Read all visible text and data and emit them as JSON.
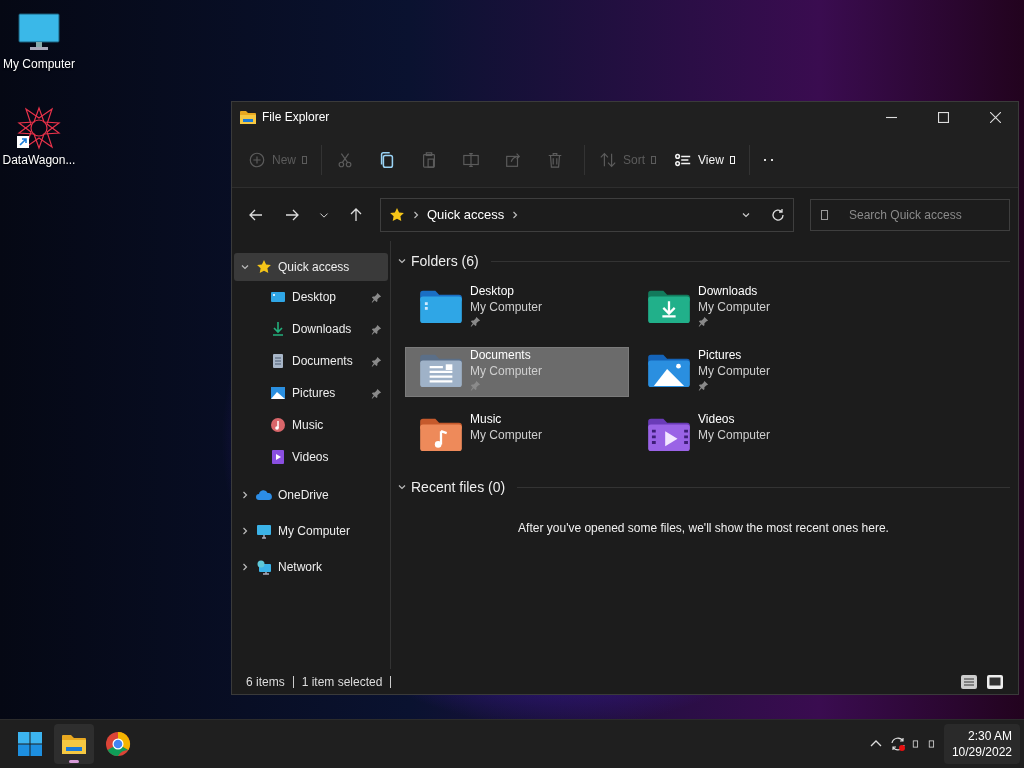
{
  "desktop_icons": [
    {
      "label": "My Computer",
      "kind": "monitor",
      "shortcut": false
    },
    {
      "label": "DataWagon...",
      "kind": "app",
      "shortcut": true
    }
  ],
  "window": {
    "title": "File Explorer"
  },
  "toolbar": [
    {
      "kind": "new",
      "label": "New",
      "disabled": true,
      "dropdown": true
    },
    {
      "kind": "cut",
      "disabled": true
    },
    {
      "kind": "copy",
      "disabled": false
    },
    {
      "kind": "paste",
      "disabled": true
    },
    {
      "kind": "rename",
      "disabled": true
    },
    {
      "kind": "share",
      "disabled": true
    },
    {
      "kind": "delete",
      "disabled": true
    },
    {
      "kind": "sort",
      "label": "Sort",
      "disabled": true,
      "dropdown": true
    },
    {
      "kind": "view",
      "label": "View",
      "disabled": false,
      "dropdown": true
    },
    {
      "kind": "more"
    }
  ],
  "address": {
    "breadcrumb": "Quick access"
  },
  "search": {
    "placeholder": "Search Quick access"
  },
  "nav": [
    {
      "label": "Quick access",
      "kind": "star",
      "expanded": true,
      "selected": true,
      "children": [
        {
          "label": "Desktop",
          "kind": "desktop",
          "pinned": true,
          "selected": false
        },
        {
          "label": "Downloads",
          "kind": "downloads",
          "pinned": true,
          "selected": false
        },
        {
          "label": "Documents",
          "kind": "documents",
          "pinned": true,
          "selected": false
        },
        {
          "label": "Pictures",
          "kind": "pictures",
          "pinned": true,
          "selected": false
        },
        {
          "label": "Music",
          "kind": "music",
          "pinned": false,
          "selected": false
        },
        {
          "label": "Videos",
          "kind": "videos",
          "pinned": false,
          "selected": false
        }
      ]
    },
    {
      "label": "OneDrive",
      "kind": "cloud",
      "expanded": false,
      "selected": false
    },
    {
      "label": "My Computer",
      "kind": "monitor",
      "expanded": false,
      "selected": false
    },
    {
      "label": "Network",
      "kind": "network",
      "expanded": false,
      "selected": false
    }
  ],
  "folders_section": {
    "title": "Folders (6)",
    "expanded": true,
    "folders": [
      {
        "name": "Desktop",
        "location": "My Computer",
        "kind": "desktop",
        "pinned": true,
        "selected": false
      },
      {
        "name": "Downloads",
        "location": "My Computer",
        "kind": "downloads",
        "pinned": true,
        "selected": false
      },
      {
        "name": "Documents",
        "location": "My Computer",
        "kind": "documents",
        "pinned": true,
        "selected": true
      },
      {
        "name": "Pictures",
        "location": "My Computer",
        "kind": "pictures",
        "pinned": true,
        "selected": false
      },
      {
        "name": "Music",
        "location": "My Computer",
        "kind": "music",
        "pinned": false,
        "selected": false
      },
      {
        "name": "Videos",
        "location": "My Computer",
        "kind": "videos",
        "pinned": false,
        "selected": false
      }
    ]
  },
  "recent_section": {
    "title": "Recent files (0)",
    "expanded": true,
    "empty_message": "After you've opened some files, we'll show the most recent ones here."
  },
  "status_bar": {
    "item_count": "6 items",
    "selection": "1 item selected"
  },
  "taskbar": {
    "apps": [
      {
        "kind": "start",
        "running": false
      },
      {
        "kind": "explorer",
        "running": true
      },
      {
        "kind": "browser",
        "running": false
      }
    ],
    "time": "2:30 AM",
    "date": "10/29/2022"
  }
}
